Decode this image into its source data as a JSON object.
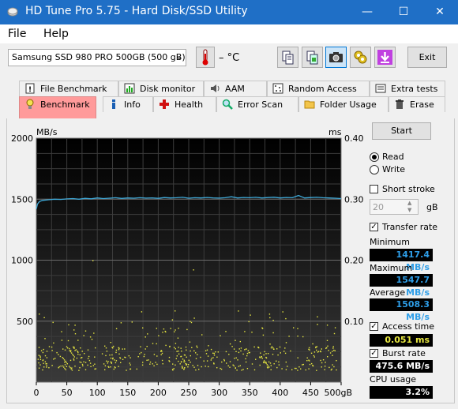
{
  "window": {
    "title": "HD Tune Pro 5.75 - Hard Disk/SSD Utility",
    "minimize": "—",
    "maximize": "☐",
    "close": "✕"
  },
  "menu": {
    "file": "File",
    "help": "Help"
  },
  "toolbar": {
    "drive": "Samsung SSD 980 PRO 500GB (500 gB)",
    "temperature": "– °C",
    "exit": "Exit"
  },
  "tabs_top": [
    "File Benchmark",
    "Disk monitor",
    "AAM",
    "Random Access",
    "Extra tests"
  ],
  "tabs_bottom": [
    "Benchmark",
    "Info",
    "Health",
    "Error Scan",
    "Folder Usage",
    "Erase"
  ],
  "controls": {
    "start": "Start",
    "read": "Read",
    "write": "Write",
    "short_stroke": "Short stroke",
    "short_stroke_value": "20",
    "short_stroke_unit": "gB",
    "transfer_rate": "Transfer rate",
    "minimum_label": "Minimum",
    "minimum_value": "1417.4 MB/s",
    "maximum_label": "Maximum",
    "maximum_value": "1547.7 MB/s",
    "average_label": "Average",
    "average_value": "1508.3 MB/s",
    "access_time": "Access time",
    "access_time_value": "0.051 ms",
    "burst_rate": "Burst rate",
    "burst_rate_value": "475.6 MB/s",
    "cpu_usage_label": "CPU usage",
    "cpu_usage_value": "3.2%"
  },
  "colors": {
    "titlebar": "#1f6fc6",
    "chart_bg": "#000000",
    "transfer_line": "#3fa9d8",
    "access_dots": "#e8e840",
    "value_blue": "#2e9ee8"
  },
  "chart_data": {
    "type": "line",
    "ylabel_left": "MB/s",
    "ylabel_right": "ms",
    "xlabel_unit": "gB",
    "x_ticks": [
      "0",
      "50",
      "100",
      "150",
      "200",
      "250",
      "300",
      "350",
      "400",
      "450",
      "500gB"
    ],
    "y_left_ticks": [
      "2000",
      "1500",
      "1000",
      "500"
    ],
    "y_right_ticks": [
      "0.40",
      "0.30",
      "0.20",
      "0.10"
    ],
    "xlim": [
      0,
      500
    ],
    "ylim_left": [
      0,
      2000
    ],
    "ylim_right": [
      0,
      0.4
    ],
    "grid": true,
    "series": [
      {
        "name": "Transfer rate",
        "axis": "left",
        "x": [
          0,
          2,
          5,
          10,
          20,
          30,
          40,
          50,
          60,
          70,
          80,
          90,
          100,
          110,
          120,
          130,
          140,
          150,
          160,
          170,
          180,
          190,
          200,
          210,
          220,
          230,
          240,
          250,
          260,
          270,
          280,
          290,
          300,
          310,
          320,
          330,
          340,
          350,
          360,
          370,
          380,
          390,
          400,
          410,
          420,
          430,
          440,
          450,
          460,
          470,
          480,
          490,
          500
        ],
        "values": [
          1420,
          1460,
          1480,
          1490,
          1495,
          1500,
          1498,
          1502,
          1505,
          1500,
          1507,
          1503,
          1510,
          1505,
          1508,
          1512,
          1506,
          1510,
          1508,
          1512,
          1509,
          1511,
          1507,
          1513,
          1510,
          1512,
          1515,
          1508,
          1512,
          1510,
          1514,
          1511,
          1509,
          1512,
          1520,
          1510,
          1514,
          1512,
          1515,
          1510,
          1513,
          1516,
          1510,
          1514,
          1512,
          1530,
          1510,
          1513,
          1515,
          1512,
          1510,
          1508,
          1505
        ]
      },
      {
        "name": "Access time",
        "axis": "right",
        "type": "scatter",
        "x_range": [
          0,
          500
        ],
        "y_range_ms": [
          0.02,
          0.12
        ],
        "dense_below_ms": 0.06
      }
    ]
  }
}
